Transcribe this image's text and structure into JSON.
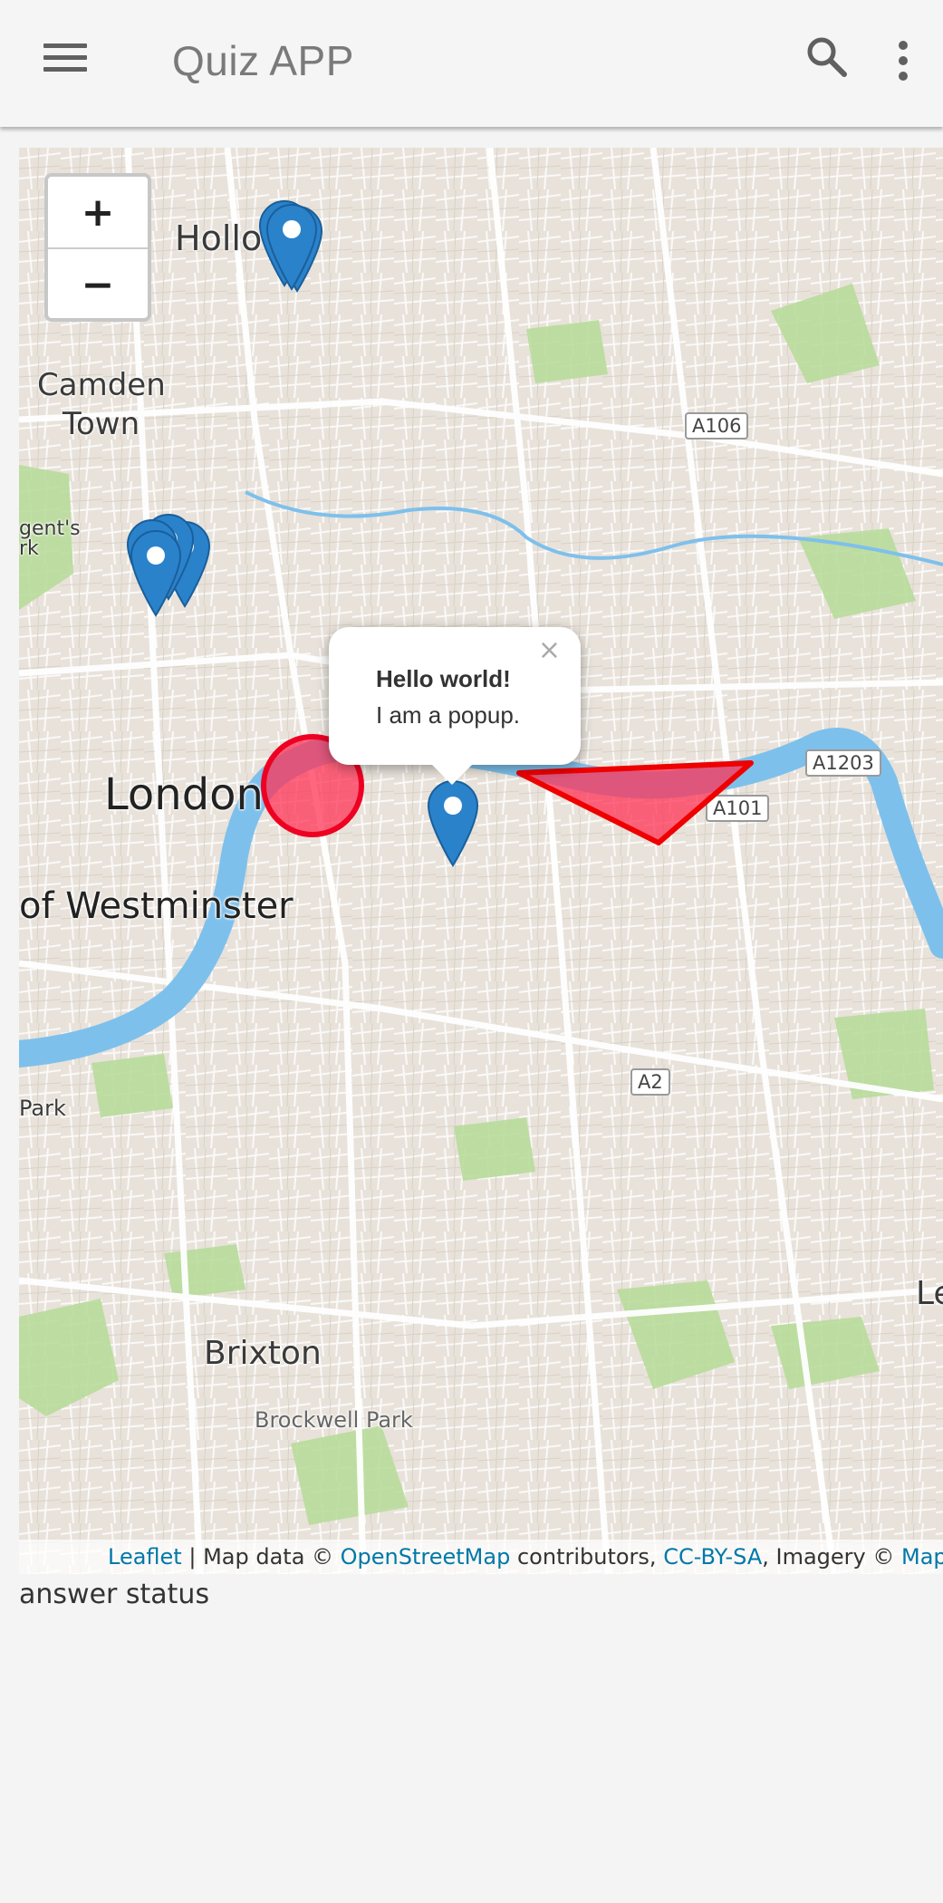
{
  "appbar": {
    "title": "Quiz APP",
    "menu_icon": "hamburger-menu-icon",
    "search_icon": "search-icon",
    "more_icon": "more-vert-icon"
  },
  "map": {
    "zoom_in_label": "+",
    "zoom_out_label": "−",
    "place_labels": {
      "holloway": "Hollo",
      "camden_1": "Camden",
      "camden_2": "Town",
      "regents_1": "gent's",
      "regents_2": "rk",
      "london": "London",
      "westminster": "of Westminster",
      "park": "Park",
      "brixton": "Brixton",
      "brockwell": "Brockwell Park",
      "right_edge": "Le"
    },
    "roads": [
      "A106",
      "A1203",
      "A101",
      "A2"
    ],
    "popup": {
      "title": "Hello world!",
      "body": "I am a popup.",
      "close": "×"
    },
    "overlay_colors": {
      "circle": "#ff3355",
      "polygon": "#ff3355",
      "outline": "#ee0000",
      "marker": "#2a82cb",
      "river": "#7ec0ec"
    },
    "attribution": {
      "leaflet": "Leaflet",
      "sep1": " | Map data © ",
      "osm": "OpenStreetMap",
      "sep2": " contributors, ",
      "license": "CC-BY-SA",
      "sep3": ", Imagery © ",
      "mapbox": "Mapbox"
    }
  },
  "status": {
    "text": "answer status"
  }
}
